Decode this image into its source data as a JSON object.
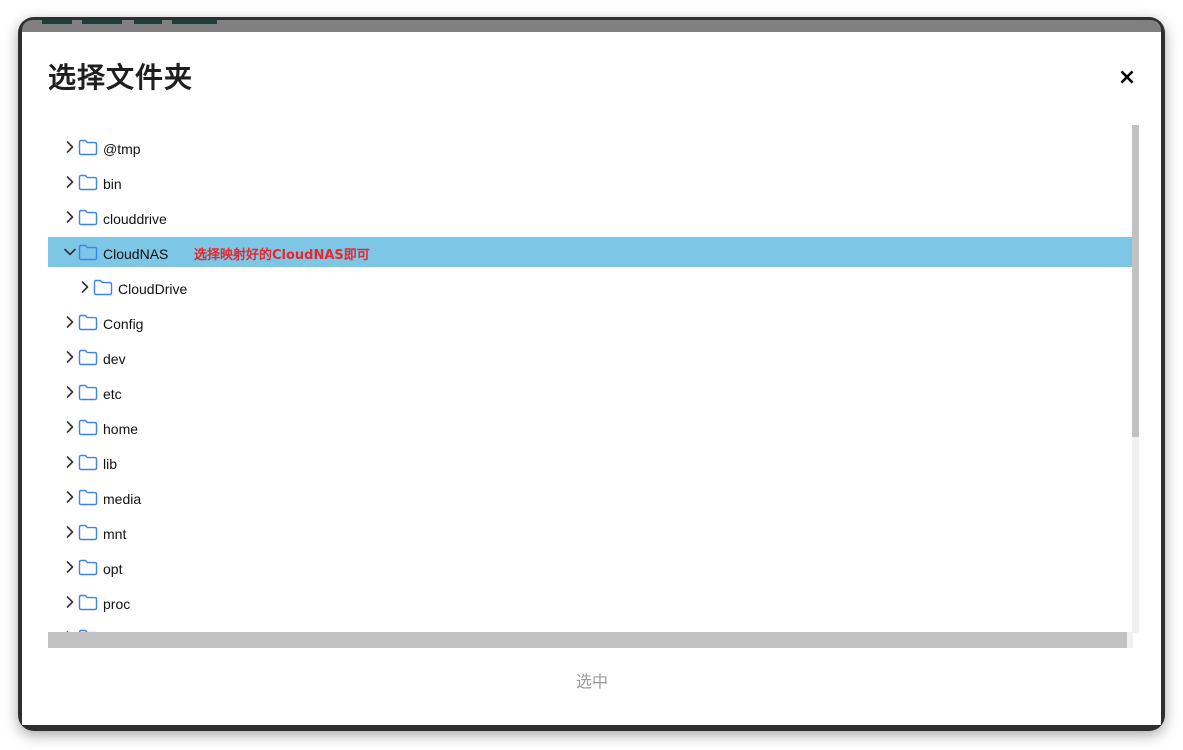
{
  "dialog": {
    "title": "选择文件夹",
    "close_label": "×",
    "confirm_label": "选中"
  },
  "tree": {
    "items": [
      {
        "label": "@tmp",
        "expanded": false,
        "selected": false,
        "depth": 0
      },
      {
        "label": "bin",
        "expanded": false,
        "selected": false,
        "depth": 0
      },
      {
        "label": "clouddrive",
        "expanded": false,
        "selected": false,
        "depth": 0
      },
      {
        "label": "CloudNAS",
        "expanded": true,
        "selected": true,
        "depth": 0
      },
      {
        "label": "CloudDrive",
        "expanded": false,
        "selected": false,
        "depth": 1
      },
      {
        "label": "Config",
        "expanded": false,
        "selected": false,
        "depth": 0
      },
      {
        "label": "dev",
        "expanded": false,
        "selected": false,
        "depth": 0
      },
      {
        "label": "etc",
        "expanded": false,
        "selected": false,
        "depth": 0
      },
      {
        "label": "home",
        "expanded": false,
        "selected": false,
        "depth": 0
      },
      {
        "label": "lib",
        "expanded": false,
        "selected": false,
        "depth": 0
      },
      {
        "label": "media",
        "expanded": false,
        "selected": false,
        "depth": 0
      },
      {
        "label": "mnt",
        "expanded": false,
        "selected": false,
        "depth": 0
      },
      {
        "label": "opt",
        "expanded": false,
        "selected": false,
        "depth": 0
      },
      {
        "label": "proc",
        "expanded": false,
        "selected": false,
        "depth": 0
      },
      {
        "label": "",
        "expanded": false,
        "selected": false,
        "depth": 0
      }
    ]
  },
  "annotation": {
    "text": "选择映射好的CloudNAS即可"
  },
  "colors": {
    "selected_row": "#7ec6e6",
    "folder_icon": "#3b82f6",
    "annotation_text": "#e8262b",
    "confirm_text": "#9a9a9a"
  },
  "icons": {
    "close": "close-icon",
    "expand": "chevron-right-icon",
    "collapse": "chevron-down-icon",
    "folder": "folder-icon"
  }
}
